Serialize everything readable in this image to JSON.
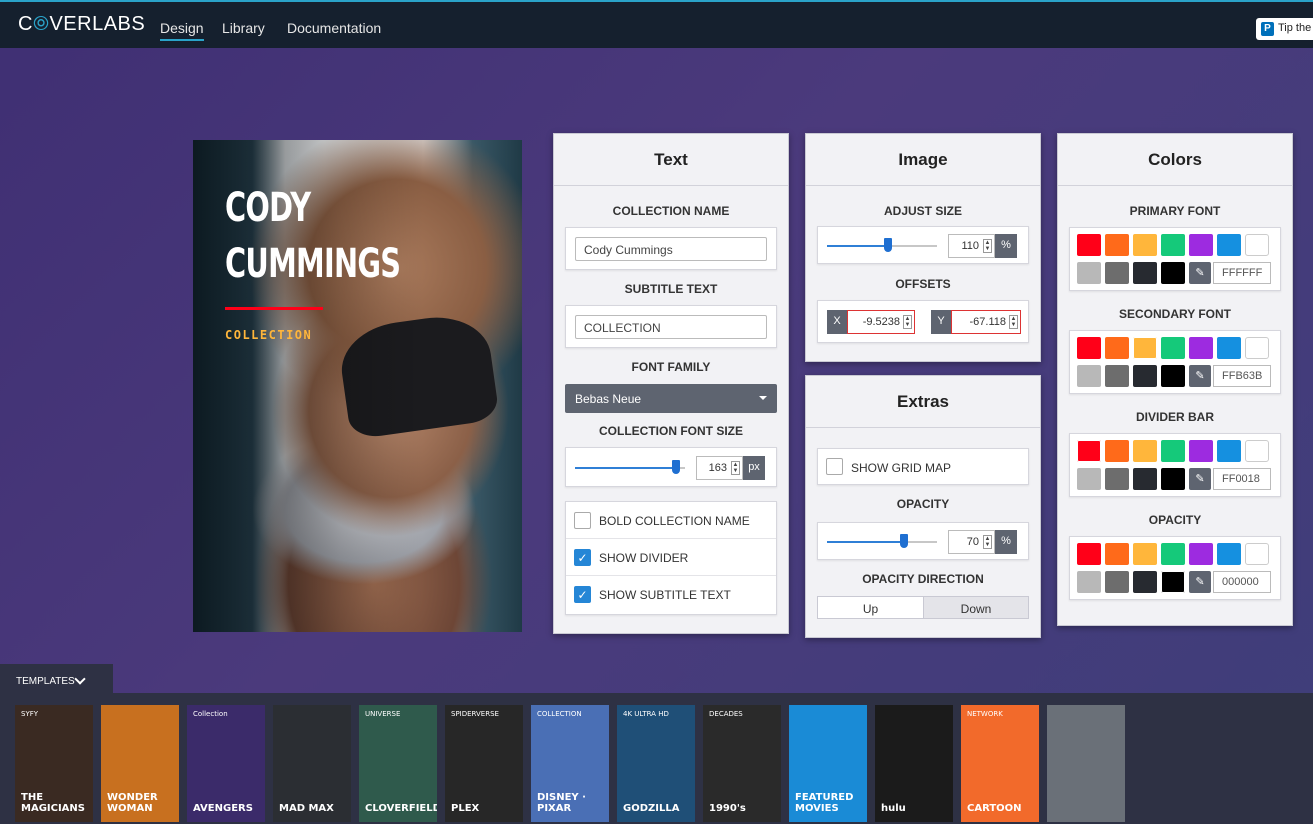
{
  "nav": {
    "logo_left": "C",
    "logo_o": "⦾",
    "logo_right": "VERLABS",
    "links": [
      "Design",
      "Library",
      "Documentation"
    ],
    "active": "Design",
    "tip_label": "Tip the",
    "tip_icon": "paypal-icon"
  },
  "poster": {
    "title_line1": "CODY",
    "title_line2": "CUMMINGS",
    "subtitle": "COLLECTION"
  },
  "text_panel": {
    "title": "Text",
    "collection_name_label": "COLLECTION NAME",
    "collection_name_value": "Cody Cummings",
    "subtitle_label": "SUBTITLE TEXT",
    "subtitle_value": "COLLECTION",
    "font_family_label": "FONT FAMILY",
    "font_family_value": "Bebas Neue",
    "font_size_label": "COLLECTION FONT SIZE",
    "font_size_value": "163",
    "font_size_unit": "px",
    "font_size_fraction": 0.92,
    "options": [
      {
        "label": "BOLD COLLECTION NAME",
        "checked": false
      },
      {
        "label": "SHOW DIVIDER",
        "checked": true
      },
      {
        "label": "SHOW SUBTITLE TEXT",
        "checked": true
      }
    ]
  },
  "image_panel": {
    "title": "Image",
    "adjust_size_label": "ADJUST SIZE",
    "size_value": "110",
    "size_unit": "%",
    "size_fraction": 0.55,
    "offsets_label": "OFFSETS",
    "x_tag": "X",
    "x_value": "-9.5238",
    "y_tag": "Y",
    "y_value": "-67.118"
  },
  "extras_panel": {
    "title": "Extras",
    "grid_map_label": "SHOW GRID MAP",
    "grid_map_checked": false,
    "opacity_label": "OPACITY",
    "opacity_value": "70",
    "opacity_unit": "%",
    "opacity_fraction": 0.7,
    "direction_label": "OPACITY DIRECTION",
    "direction_options": [
      "Up",
      "Down"
    ],
    "direction_selected": "Up"
  },
  "colors_panel": {
    "title": "Colors",
    "palette": [
      "#ff0018",
      "#ff6a1a",
      "#ffb63b",
      "#15c97a",
      "#9d2be0",
      "#1590e0",
      "#ffffff",
      "#b8b8b8",
      "#6d6d6d",
      "#272a30",
      "#000000"
    ],
    "groups": [
      {
        "label": "PRIMARY FONT",
        "hex": "FFFFFF",
        "selected": 6
      },
      {
        "label": "SECONDARY FONT",
        "hex": "FFB63B",
        "selected": 2
      },
      {
        "label": "DIVIDER BAR",
        "hex": "FF0018",
        "selected": 0
      },
      {
        "label": "OPACITY",
        "hex": "000000",
        "selected": 10
      }
    ],
    "picker_icon": "eyedropper-icon"
  },
  "templates": {
    "label": "TEMPLATES",
    "toggle_icon": "chevron-down-icon",
    "items": [
      {
        "name": "THE MAGICIANS",
        "top": "SYFY",
        "bg": "#3a2a22"
      },
      {
        "name": "WONDER WOMAN",
        "top": "",
        "bg": "#c8701f"
      },
      {
        "name": "AVENGERS",
        "top": "Collection",
        "bg": "#3b2b6a"
      },
      {
        "name": "MAD MAX",
        "top": "",
        "bg": "#2b2e33"
      },
      {
        "name": "CLOVERFIELD",
        "top": "UNIVERSE",
        "bg": "#2f5a4c"
      },
      {
        "name": "PLEX",
        "top": "SPIDERVERSE",
        "bg": "#272727"
      },
      {
        "name": "DISNEY · PIXAR",
        "top": "COLLECTION",
        "bg": "#4a6fb5"
      },
      {
        "name": "GODZILLA",
        "top": "4K ULTRA HD",
        "bg": "#1f4f77"
      },
      {
        "name": "1990's",
        "top": "DECADES",
        "bg": "#2a2a2a"
      },
      {
        "name": "FEATURED MOVIES",
        "top": "",
        "bg": "#1a8bd6"
      },
      {
        "name": "hulu",
        "top": "",
        "bg": "#1b1b1b"
      },
      {
        "name": "CARTOON",
        "top": "NETWORK",
        "bg": "#f26a2b"
      },
      {
        "name": "",
        "top": "",
        "bg": "#6a7078"
      }
    ]
  }
}
